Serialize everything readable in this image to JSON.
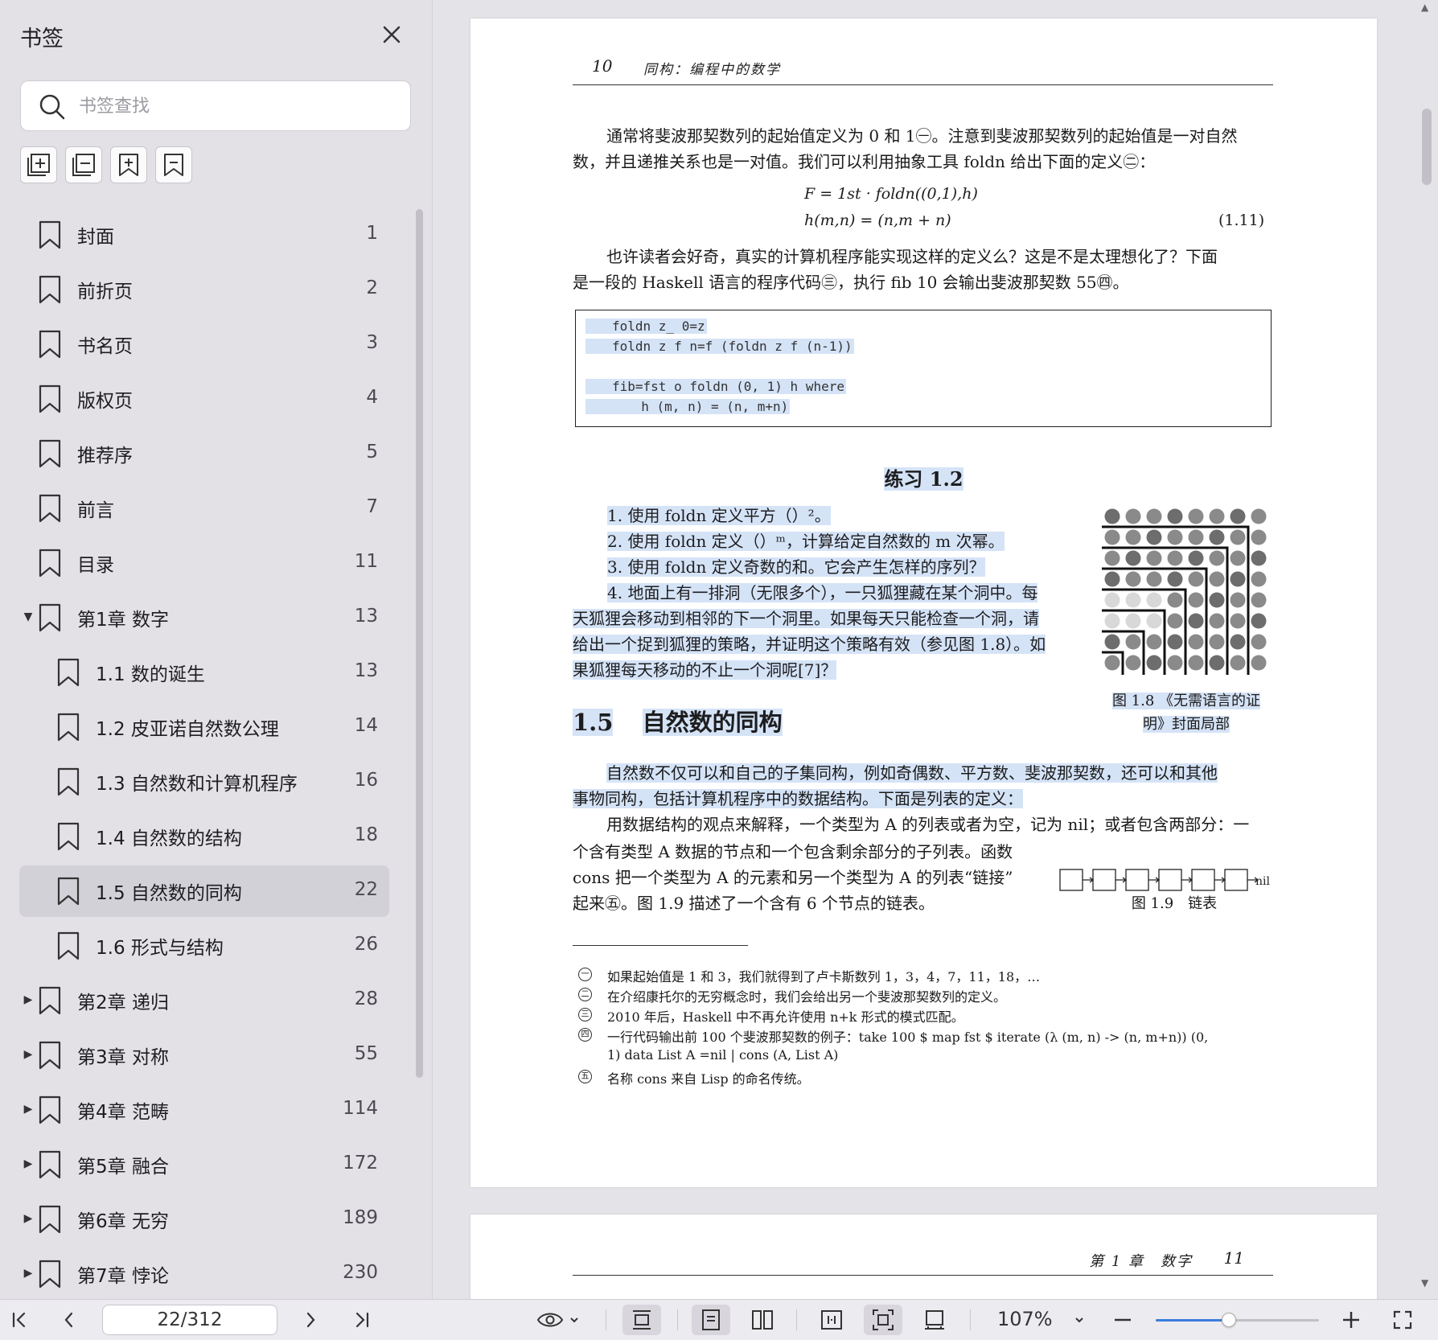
{
  "sidebar": {
    "title": "书签",
    "search_placeholder": "书签查找",
    "bookmarks": [
      {
        "label": "封面",
        "page": "1",
        "level": 0,
        "caret": ""
      },
      {
        "label": "前折页",
        "page": "2",
        "level": 0,
        "caret": ""
      },
      {
        "label": "书名页",
        "page": "3",
        "level": 0,
        "caret": ""
      },
      {
        "label": "版权页",
        "page": "4",
        "level": 0,
        "caret": ""
      },
      {
        "label": "推荐序",
        "page": "5",
        "level": 0,
        "caret": ""
      },
      {
        "label": "前言",
        "page": "7",
        "level": 0,
        "caret": ""
      },
      {
        "label": "目录",
        "page": "11",
        "level": 0,
        "caret": ""
      },
      {
        "label": "第1章 数字",
        "page": "13",
        "level": 0,
        "caret": "▼"
      },
      {
        "label": "1.1 数的诞生",
        "page": "13",
        "level": 1,
        "caret": ""
      },
      {
        "label": "1.2 皮亚诺自然数公理",
        "page": "14",
        "level": 1,
        "caret": ""
      },
      {
        "label": "1.3 自然数和计算机程序",
        "page": "16",
        "level": 1,
        "caret": ""
      },
      {
        "label": "1.4 自然数的结构",
        "page": "18",
        "level": 1,
        "caret": ""
      },
      {
        "label": "1.5 自然数的同构",
        "page": "22",
        "level": 1,
        "caret": "",
        "active": true
      },
      {
        "label": "1.6 形式与结构",
        "page": "26",
        "level": 1,
        "caret": ""
      },
      {
        "label": "第2章 递归",
        "page": "28",
        "level": 0,
        "caret": "▶"
      },
      {
        "label": "第3章 对称",
        "page": "55",
        "level": 0,
        "caret": "▶"
      },
      {
        "label": "第4章 范畴",
        "page": "114",
        "level": 0,
        "caret": "▶"
      },
      {
        "label": "第5章 融合",
        "page": "172",
        "level": 0,
        "caret": "▶"
      },
      {
        "label": "第6章 无穷",
        "page": "189",
        "level": 0,
        "caret": "▶"
      },
      {
        "label": "第7章 悖论",
        "page": "230",
        "level": 0,
        "caret": "▶"
      }
    ]
  },
  "page1": {
    "running_head_num": "10",
    "running_head_title": "同构：编程中的数学",
    "para1_line1": "通常将斐波那契数列的起始值定义为 0 和 1㊀。注意到斐波那契数列的起始值是一对自然",
    "para1_line2": "数，并且递推关系也是一对值。我们可以利用抽象工具 foldn 给出下面的定义㊁：",
    "eq1": "F = 1st · foldn((0,1),h)",
    "eq2": "h(m,n) = (n,m + n)",
    "eq_num": "(1.11)",
    "para2_line1": "也许读者会好奇，真实的计算机程序能实现这样的定义么？这是不是太理想化了？下面",
    "para2_line2": "是一段的 Haskell 语言的程序代码㊂，执行 fib 10 会输出斐波那契数 55㊃。",
    "code": [
      "foldn z_ 0=z",
      "foldn z f n=f (foldn z f (n-1))",
      "",
      "fib=fst o foldn (0, 1) h where",
      "  h (m, n) = (n, m+n)"
    ],
    "exercise_title": "练习 1.2",
    "exercises": [
      "1. 使用 foldn 定义平方（）²。",
      "2. 使用 foldn 定义（）ᵐ，计算给定自然数的 m 次幂。",
      "3. 使用 foldn 定义奇数的和。它会产生怎样的序列？",
      "4. 地面上有一排洞（无限多个），一只狐狸藏在某个洞中。每",
      "天狐狸会移动到相邻的下一个洞里。如果每天只能检查一个洞，请",
      "给出一个捉到狐狸的策略，并证明这个策略有效（参见图 1.8）。如",
      "果狐狸每天移动的不止一个洞呢[7]？"
    ],
    "fig18_caption_1": "图 1.8 《无需语言的证",
    "fig18_caption_2": "明》封面局部",
    "section_num": "1.5",
    "section_title": "自然数的同构",
    "para3_line1": "自然数不仅可以和自己的子集同构，例如奇偶数、平方数、斐波那契数，还可以和其他",
    "para3_line2": "事物同构，包括计算机程序中的数据结构。下面是列表的定义：",
    "para4_line1": "用数据结构的观点来解释，一个类型为 A 的列表或者为空，记为 nil；或者包含两部分：一",
    "para4_line2": "个含有类型 A 数据的节点和一个包含剩余部分的子列表。函数",
    "para4_line3": "cons 把一个类型为 A 的元素和另一个类型为 A 的列表“链接”",
    "para4_line4": "起来㊄。图 1.9 描述了一个含有 6 个节点的链表。",
    "fig19_nil": "nil",
    "fig19_caption": "图 1.9　链表",
    "footnotes": [
      {
        "mark": "一",
        "text": "如果起始值是 1 和 3，我们就得到了卢卡斯数列 1，3，4，7，11，18，…"
      },
      {
        "mark": "二",
        "text": "在介绍康托尔的无穷概念时，我们会给出另一个斐波那契数列的定义。"
      },
      {
        "mark": "三",
        "text": "2010 年后，Haskell 中不再允许使用 n+k 形式的模式匹配。"
      },
      {
        "mark": "四",
        "text": "一行代码输出前 100 个斐波那契数的例子：take 100 $ map fst $ iterate (λ (m, n) -> (n, m+n)) (0,"
      },
      {
        "mark": "",
        "text": "1) data List A =nil | cons (A, List A)"
      },
      {
        "mark": "五",
        "text": "名称 cons 来自 Lisp 的命名传统。"
      }
    ]
  },
  "page2": {
    "running_head_title": "第 1 章　数字",
    "running_head_num": "11"
  },
  "toolbar": {
    "page_value": "22/312",
    "zoom": "107%",
    "zoom_fraction": 0.45
  }
}
